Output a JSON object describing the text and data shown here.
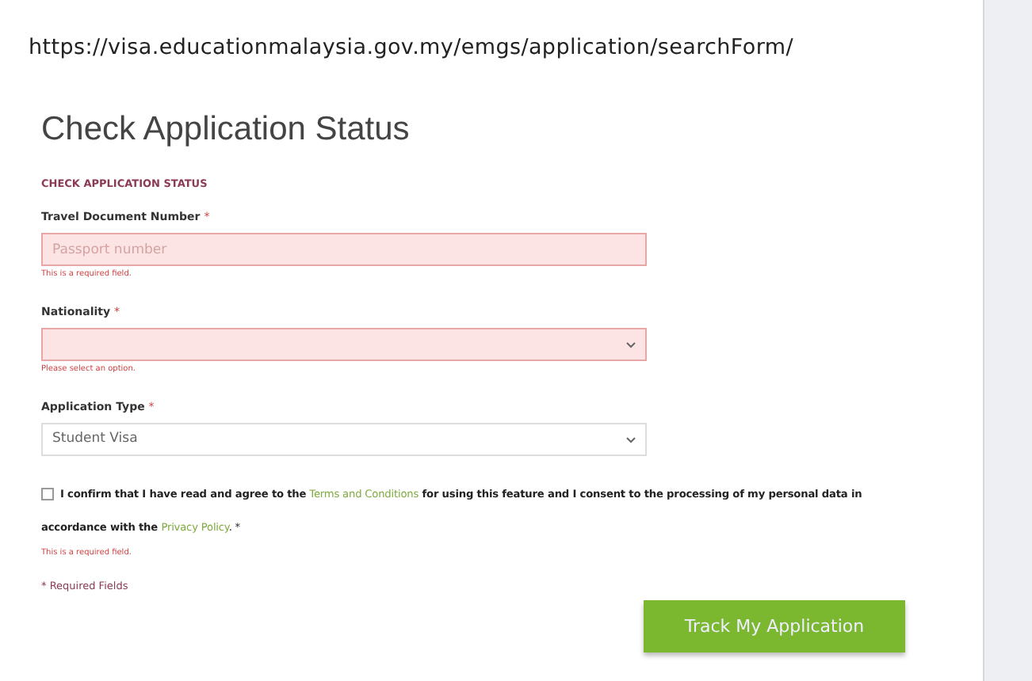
{
  "url": "https://visa.educationmalaysia.gov.my/emgs/application/searchForm/",
  "title": "Check Application Status",
  "section": "CHECK APPLICATION STATUS",
  "fields": [
    {
      "kind": "text",
      "label": "Travel Document Number",
      "required_mark": "*",
      "placeholder": "Passport number",
      "invalid": true,
      "error": "This is a required field."
    },
    {
      "kind": "select",
      "label": "Nationality",
      "required_mark": "*",
      "invalid": true,
      "error": "Please select an option."
    },
    {
      "kind": "select",
      "label": "Application Type",
      "required_mark": "*",
      "value": "Student Visa",
      "invalid": false
    }
  ],
  "consent": {
    "checked": false,
    "text": "**I confirm that I have read and agree to the** ",
    "link1": "Terms and Conditions",
    "text2": "for using this feature and I consent to the processing of my personal data in accordance with the",
    "link2": "Privacy Policy",
    "text3": ". *",
    "error": "This is a required field."
  },
  "required_note": "* Required Fields",
  "button": "Track My Application"
}
